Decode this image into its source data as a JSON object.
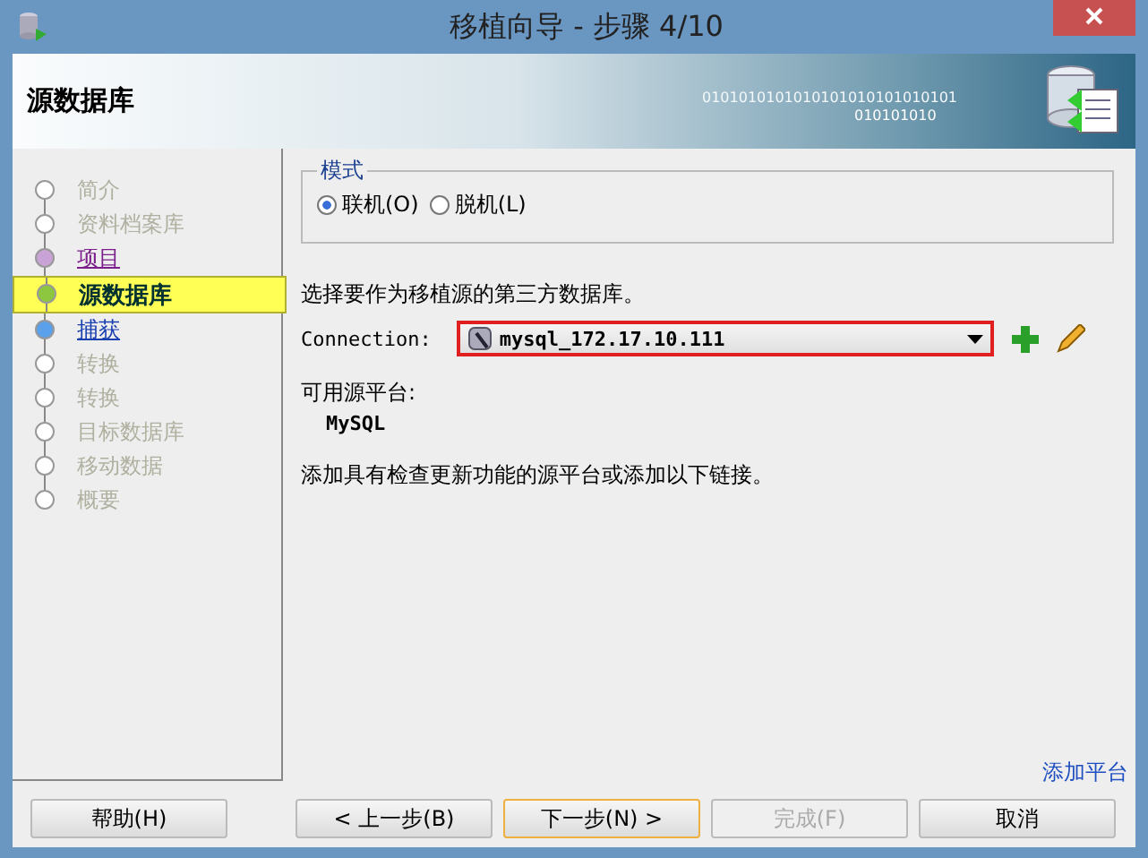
{
  "window": {
    "title": "移植向导 - 步骤 4/10"
  },
  "header": {
    "title": "源数据库",
    "binary_text": "0101010101010101010101010101",
    "binary_text_2": "010101010"
  },
  "steps": [
    {
      "label": "简介",
      "kind": "disabled"
    },
    {
      "label": "资料档案库",
      "kind": "disabled"
    },
    {
      "label": "项目",
      "kind": "visited"
    },
    {
      "label": "源数据库",
      "kind": "current"
    },
    {
      "label": "捕获",
      "kind": "link"
    },
    {
      "label": "转换",
      "kind": "disabled"
    },
    {
      "label": "转换",
      "kind": "disabled"
    },
    {
      "label": "目标数据库",
      "kind": "disabled"
    },
    {
      "label": "移动数据",
      "kind": "disabled"
    },
    {
      "label": "概要",
      "kind": "disabled"
    }
  ],
  "mode": {
    "legend": "模式",
    "options": [
      {
        "label": "联机(O)",
        "selected": true
      },
      {
        "label": "脱机(L)",
        "selected": false
      }
    ]
  },
  "instruction": "选择要作为移植源的第三方数据库。",
  "connection": {
    "label": "Connection:",
    "value": "mysql_172.17.10.111"
  },
  "platforms": {
    "label": "可用源平台:",
    "items": [
      "MySQL"
    ]
  },
  "note": "添加具有检查更新功能的源平台或添加以下链接。",
  "add_platform_link": "添加平台",
  "buttons": [
    {
      "label": "帮助(H)",
      "disabled": false,
      "default": false
    },
    {
      "label": "< 上一步(B)",
      "disabled": false,
      "default": false
    },
    {
      "label": "下一步(N) >",
      "disabled": false,
      "default": true
    },
    {
      "label": "完成(F)",
      "disabled": true,
      "default": false
    },
    {
      "label": "取消",
      "disabled": false,
      "default": false
    }
  ]
}
